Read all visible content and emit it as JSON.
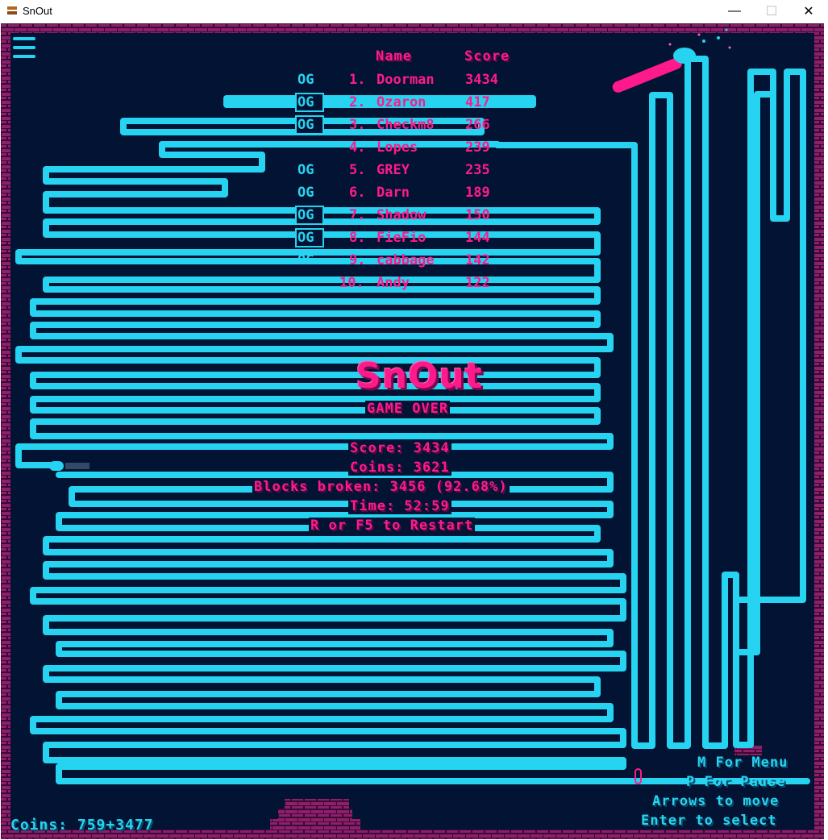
{
  "window": {
    "title": "SnOut",
    "minimize_glyph": "—",
    "maximize_glyph": "☐",
    "close_glyph": "✕"
  },
  "colors": {
    "background": "#031333",
    "snake": "#26d3f0",
    "accent": "#ff1a8c",
    "brick": "#8c1f6e"
  },
  "icons": {
    "menu": "hamburger-menu-icon",
    "app": "snout-app-icon",
    "paddle": "pink-paddle-sprite",
    "ball": "snake-head-ball"
  },
  "leaderboard": {
    "header_name": "Name",
    "header_score": "Score",
    "entries": [
      {
        "og": "OG",
        "rank": "1.",
        "name": "Doorman",
        "score": "3434"
      },
      {
        "og": "OG",
        "rank": "2.",
        "name": "Ozaron",
        "score": "417"
      },
      {
        "og": "OG",
        "rank": "3.",
        "name": "Checkm8",
        "score": "266"
      },
      {
        "og": "",
        "rank": "4.",
        "name": "Lopes",
        "score": "239"
      },
      {
        "og": "OG",
        "rank": "5.",
        "name": "GREY",
        "score": "235"
      },
      {
        "og": "OG",
        "rank": "6.",
        "name": "Darn",
        "score": "189"
      },
      {
        "og": "OG",
        "rank": "7.",
        "name": "Shadow",
        "score": "150"
      },
      {
        "og": "OG",
        "rank": "8.",
        "name": "FieFio",
        "score": "144"
      },
      {
        "og": "OG",
        "rank": "9.",
        "name": "cabbage",
        "score": "142"
      },
      {
        "og": "",
        "rank": "10.",
        "name": "Andy",
        "score": "122"
      }
    ]
  },
  "game_over": {
    "logo": "SnOut",
    "title": "GAME OVER",
    "score": "Score: 3434",
    "coins": "Coins: 3621",
    "blocks": "Blocks broken: 3456 (92.68%)",
    "time": "Time: 52:59",
    "restart": "R or F5 to Restart"
  },
  "hud": {
    "coins": "Coins: 759+3477",
    "help_menu": "M For Menu",
    "help_pause": "P For Pause",
    "help_move": "Arrows to move",
    "help_select": "Enter to select"
  }
}
